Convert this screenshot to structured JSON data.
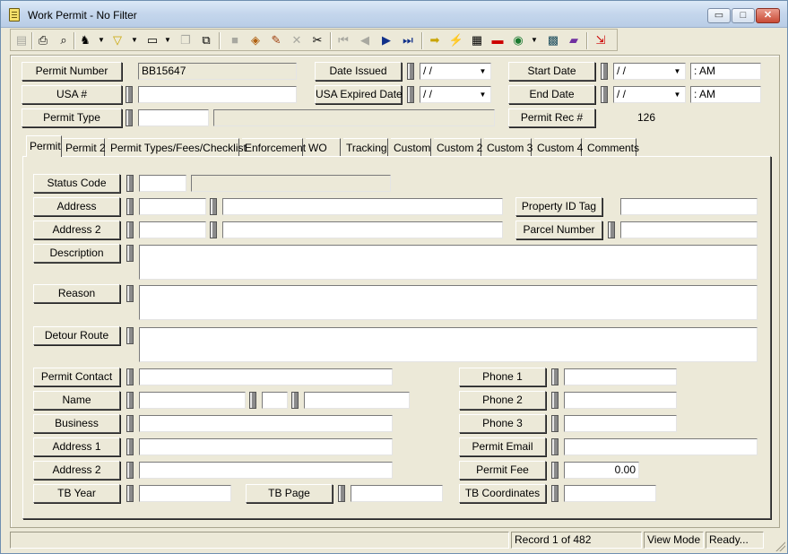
{
  "window": {
    "title": "Work Permit - No Filter",
    "controls": {
      "minimize": "▭",
      "maximize": "□",
      "close": "✕"
    }
  },
  "toolbar": {
    "icons": [
      "list-view-icon",
      "print-icon",
      "print-preview-icon",
      "find-icon",
      "filter-icon",
      "new-record-icon",
      "copy-record-icon",
      "save-icon",
      "attach-icon",
      "edit-icon",
      "delete-icon",
      "cut-icon",
      "first-record-icon",
      "previous-record-icon",
      "next-record-icon",
      "last-record-icon",
      "goto-arrow-icon",
      "lightning-icon",
      "report-icon",
      "toolbox-icon",
      "globe-icon",
      "calculator-icon",
      "notebook-icon",
      "exit-icon"
    ]
  },
  "header": {
    "permit_number": {
      "label": "Permit Number",
      "value": "BB15647"
    },
    "usa_number": {
      "label": "USA #",
      "value": ""
    },
    "permit_type": {
      "label": "Permit Type",
      "code": "",
      "description": ""
    },
    "date_issued": {
      "label": "Date Issued",
      "value": " / /"
    },
    "usa_expired_date": {
      "label": "USA Expired Date",
      "value": " / /"
    },
    "start_date": {
      "label": "Start Date",
      "value": " / /",
      "time": " :  AM"
    },
    "end_date": {
      "label": "End Date",
      "value": " / /",
      "time": " :  AM"
    },
    "permit_rec": {
      "label": "Permit Rec #",
      "value": "126"
    }
  },
  "tabs": [
    {
      "label": "Permit",
      "active": true
    },
    {
      "label": "Permit 2",
      "active": false
    },
    {
      "label": "Permit Types/Fees/Checklist",
      "active": false
    },
    {
      "label": "Enforcement",
      "active": false
    },
    {
      "label": "WO",
      "active": false
    },
    {
      "label": "Tracking",
      "active": false
    },
    {
      "label": "Custom",
      "active": false
    },
    {
      "label": "Custom 2",
      "active": false
    },
    {
      "label": "Custom 3",
      "active": false
    },
    {
      "label": "Custom 4",
      "active": false
    },
    {
      "label": "Comments",
      "active": false
    }
  ],
  "permit_tab": {
    "status_code": {
      "label": "Status Code",
      "code": "",
      "description": ""
    },
    "address": {
      "label": "Address",
      "number": "",
      "street": ""
    },
    "address_2": {
      "label": "Address 2",
      "number": "",
      "street": ""
    },
    "property_id_tag": {
      "label": "Property ID Tag",
      "value": ""
    },
    "parcel_number": {
      "label": "Parcel Number",
      "value": ""
    },
    "description": {
      "label": "Description",
      "value": ""
    },
    "reason": {
      "label": "Reason",
      "value": ""
    },
    "detour_route": {
      "label": "Detour Route",
      "value": ""
    },
    "permit_contact": {
      "label": "Permit Contact",
      "value": ""
    },
    "name": {
      "label": "Name",
      "first": "",
      "middle": "",
      "last": ""
    },
    "business": {
      "label": "Business",
      "value": ""
    },
    "address_1": {
      "label": "Address 1",
      "value": ""
    },
    "contact_address_2": {
      "label": "Address 2",
      "value": ""
    },
    "tb_year": {
      "label": "TB Year",
      "value": ""
    },
    "tb_page": {
      "label": "TB Page",
      "value": ""
    },
    "phone_1": {
      "label": "Phone 1",
      "value": ""
    },
    "phone_2": {
      "label": "Phone 2",
      "value": ""
    },
    "phone_3": {
      "label": "Phone 3",
      "value": ""
    },
    "permit_email": {
      "label": "Permit Email",
      "value": ""
    },
    "permit_fee": {
      "label": "Permit Fee",
      "value": "0.00"
    },
    "tb_coordinates": {
      "label": "TB Coordinates",
      "value": ""
    }
  },
  "statusbar": {
    "record": "Record 1 of 482",
    "mode": "View Mode",
    "status": "Ready..."
  }
}
